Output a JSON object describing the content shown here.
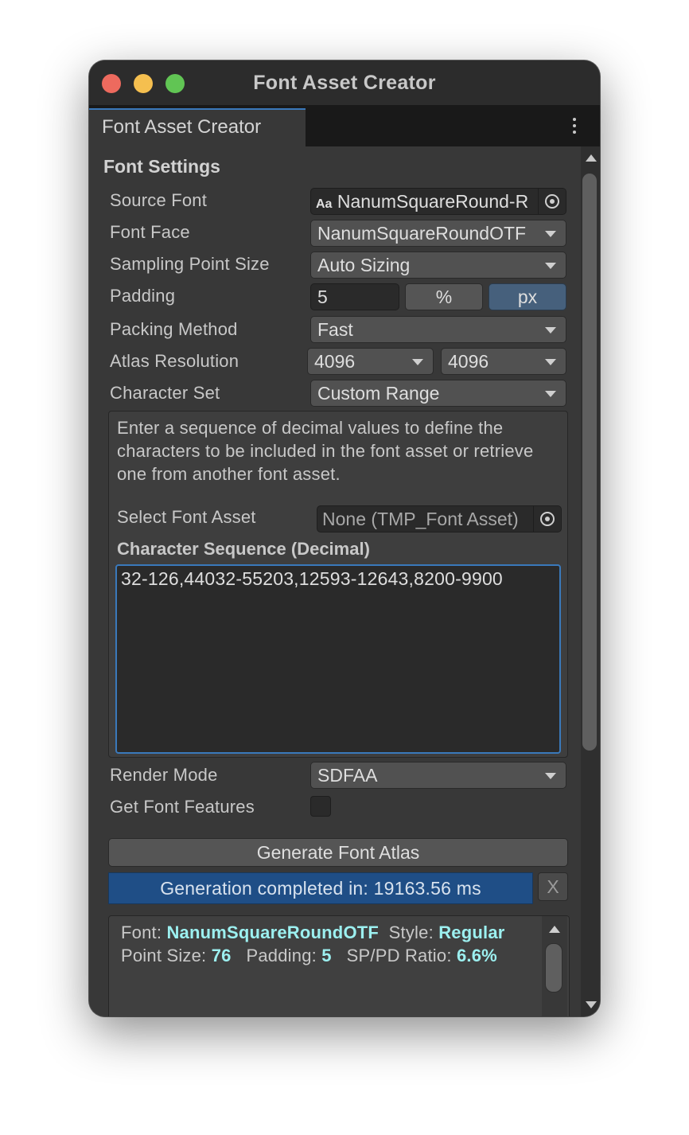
{
  "window": {
    "title": "Font Asset Creator"
  },
  "tab": {
    "label": "Font Asset Creator"
  },
  "section": {
    "title": "Font Settings"
  },
  "fields": {
    "source_font": {
      "label": "Source Font",
      "icon_text": "Aa",
      "value": "NanumSquareRound-R"
    },
    "font_face": {
      "label": "Font Face",
      "value": "NanumSquareRoundOTF"
    },
    "sampling_point_size": {
      "label": "Sampling Point Size",
      "value": "Auto Sizing"
    },
    "padding": {
      "label": "Padding",
      "value": "5",
      "percent_label": "%",
      "px_label": "px",
      "selected_unit": "px"
    },
    "packing_method": {
      "label": "Packing Method",
      "value": "Fast"
    },
    "atlas_resolution": {
      "label": "Atlas Resolution",
      "width": "4096",
      "height": "4096"
    },
    "character_set": {
      "label": "Character Set",
      "value": "Custom Range"
    },
    "help_text": "Enter a sequence of decimal values to define the characters to be included in the font asset or retrieve one from another font asset.",
    "select_font_asset": {
      "label": "Select Font Asset",
      "value": "None (TMP_Font Asset)"
    },
    "character_sequence": {
      "label": "Character Sequence (Decimal)",
      "value": "32-126,44032-55203,12593-12643,8200-9900"
    },
    "render_mode": {
      "label": "Render Mode",
      "value": "SDFAA"
    },
    "get_font_features": {
      "label": "Get Font Features",
      "checked": false
    }
  },
  "actions": {
    "generate_label": "Generate Font Atlas",
    "progress_text": "Generation completed in: 19163.56 ms",
    "progress_fraction": 1.0,
    "close_label": "X"
  },
  "info": {
    "font_label": "Font:",
    "font_value": "NanumSquareRoundOTF",
    "style_label": "Style:",
    "style_value": "Regular",
    "point_size_label": "Point Size:",
    "point_size_value": "76",
    "padding_label": "Padding:",
    "padding_value": "5",
    "ratio_label": "SP/PD Ratio:",
    "ratio_value": "6.6%"
  },
  "colors": {
    "accent_blue": "#3a79bb",
    "progress_fill": "#1f4e86",
    "highlight_text": "#9cf0f0",
    "traffic_red": "#ed6a5e",
    "traffic_yellow": "#f5bf4f",
    "traffic_green": "#61c554"
  },
  "icons": {
    "close": "close-icon",
    "minimize": "minimize-icon",
    "zoom": "zoom-icon",
    "menu": "kebab-menu-icon",
    "object_picker": "object-picker-icon",
    "dropdown": "chevron-down-icon"
  }
}
